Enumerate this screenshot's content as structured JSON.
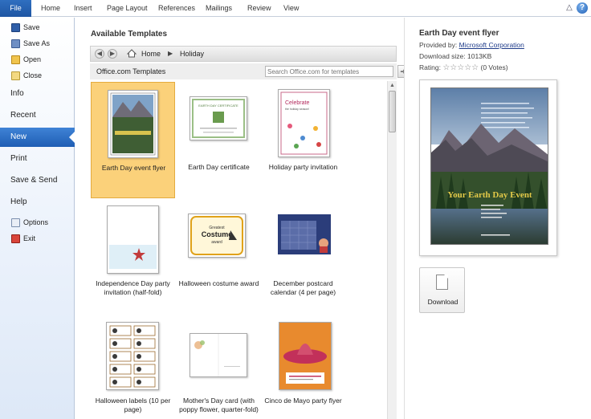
{
  "ribbon": {
    "file": "File",
    "tabs": [
      "Home",
      "Insert",
      "Page Layout",
      "References",
      "Mailings",
      "Review",
      "View"
    ],
    "help_icon": "question-icon"
  },
  "nav": {
    "commands_top": [
      {
        "label": "Save",
        "icon": "save-icon"
      },
      {
        "label": "Save As",
        "icon": "save-as-icon"
      },
      {
        "label": "Open",
        "icon": "open-folder-icon"
      },
      {
        "label": "Close",
        "icon": "close-file-icon"
      }
    ],
    "items": [
      "Info",
      "Recent",
      "New",
      "Print",
      "Save & Send",
      "Help"
    ],
    "active": "New",
    "commands_bottom": [
      {
        "label": "Options",
        "icon": "options-icon"
      },
      {
        "label": "Exit",
        "icon": "exit-icon"
      }
    ]
  },
  "main": {
    "title": "Available Templates",
    "breadcrumb": {
      "home": "Home",
      "current": "Holiday"
    },
    "section_label": "Office.com Templates",
    "search_placeholder": "Search Office.com for templates",
    "templates": [
      {
        "label": "Earth Day event flyer",
        "selected": true
      },
      {
        "label": "Earth Day certificate",
        "selected": false
      },
      {
        "label": "Holiday party invitation",
        "selected": false
      },
      {
        "label": "Independence Day party invitation (half-fold)",
        "selected": false
      },
      {
        "label": "Halloween costume award",
        "selected": false
      },
      {
        "label": "December postcard calendar (4 per page)",
        "selected": false
      },
      {
        "label": "Halloween labels (10 per page)",
        "selected": false
      },
      {
        "label": "Mother's Day card (with poppy flower, quarter-fold)",
        "selected": false
      },
      {
        "label": "Cinco de Mayo party flyer",
        "selected": false
      }
    ],
    "thumb_text": {
      "cert": "EARTH DAY CERTIFICATE",
      "celebrate": "Celebrate",
      "celebrate_sub": "the holiday season!",
      "costume_1": "Greatest",
      "costume_2": "Costume",
      "costume_3": "award"
    }
  },
  "preview": {
    "title": "Earth Day event flyer",
    "provided_by_label": "Provided by:",
    "provider": "Microsoft Corporation",
    "download_size": "Download size: 1013KB",
    "rating_label": "Rating:",
    "stars": "☆☆☆☆☆",
    "votes": "(0 Votes)",
    "flyer_headline": "Your Earth Day Event",
    "download_label": "Download"
  },
  "colors": {
    "accent": "#1f5eb4",
    "selected_tile": "#fbd17a",
    "link": "#1f3c8a"
  }
}
